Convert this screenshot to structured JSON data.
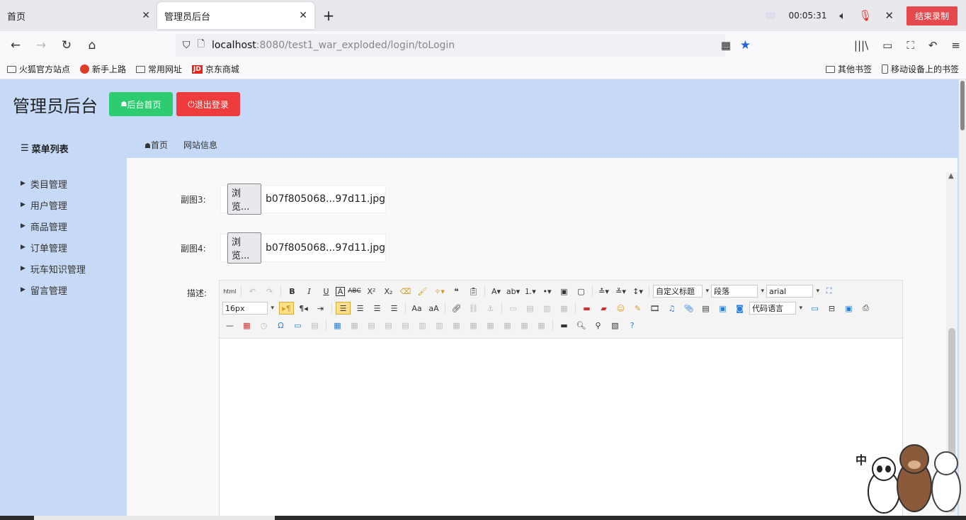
{
  "tabs": [
    {
      "label": "首页",
      "active": false
    },
    {
      "label": "管理员后台",
      "active": true
    }
  ],
  "recorder": {
    "time": "00:05:31",
    "stop_label": "结束录制"
  },
  "address": {
    "host": "localhost",
    "rest": ":8080/test1_war_exploded/login/toLogin"
  },
  "bookmarks": [
    "火狐官方站点",
    "新手上路",
    "常用网址",
    "京东商城"
  ],
  "bookmarks_right": [
    "其他书签",
    "移动设备上的书签"
  ],
  "app": {
    "title": "管理员后台",
    "home_btn": "后台首页",
    "logout_btn": "退出登录"
  },
  "menu": {
    "heading": "菜单列表",
    "items": [
      "类目管理",
      "用户管理",
      "商品管理",
      "订单管理",
      "玩车知识管理",
      "留言管理"
    ]
  },
  "breadcrumbs": [
    "首页",
    "网站信息"
  ],
  "form": {
    "rows": [
      {
        "label": "副图3:",
        "button": "浏览...",
        "file": "b07f805068...97d11.jpg"
      },
      {
        "label": "副图4:",
        "button": "浏览...",
        "file": "b07f805068...97d11.jpg"
      }
    ],
    "desc_label": "描述:"
  },
  "editor": {
    "heading_select": "自定义标题",
    "para_select": "段落",
    "font_select": "arial",
    "size_select": "16px",
    "code_select": "代码语言",
    "source_label": "html"
  },
  "sticker": {
    "char": "中"
  }
}
